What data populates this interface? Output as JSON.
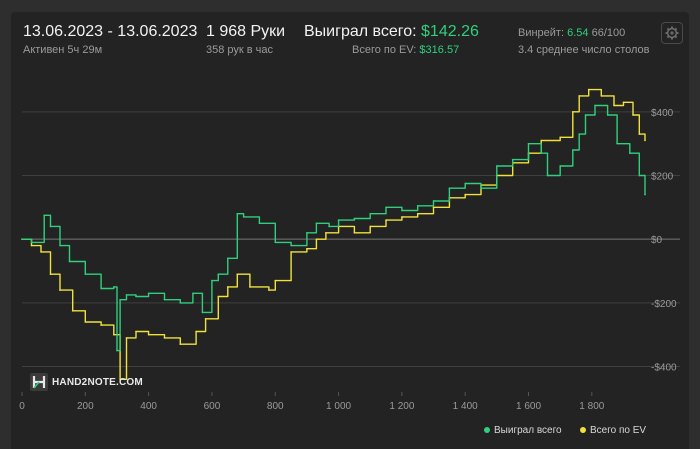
{
  "header": {
    "date_range": "13.06.2023 - 13.06.2023",
    "active": "Активен 5ч 29м",
    "hands": "1 968 Руки",
    "hands_per_hour": "358 рук в час",
    "won_label": "Выиграл всего:",
    "won_value": "$142.26",
    "ev_label": "Всего по EV:",
    "ev_value": "$316.57",
    "winrate_label": "Винрейт:",
    "winrate_value": "6.54",
    "winrate_suffix": "66/100",
    "tables": "3.4 среднее число столов"
  },
  "logo": {
    "text": "HAND2NOTE.COM"
  },
  "icons": {
    "settings": "gear-icon",
    "logo": "hand2note-logo-icon"
  },
  "colors": {
    "won": "#2ed07d",
    "ev": "#f0e23a",
    "accent_green": "#2ed07d",
    "grid": "#555555"
  },
  "chart_data": {
    "type": "line",
    "x_ticks": [
      "0",
      "200",
      "400",
      "600",
      "800",
      "1 000",
      "1 200",
      "1 400",
      "1 600",
      "1 800"
    ],
    "y_ticks": [
      "$400",
      "$200",
      "$0",
      "-$200",
      "-$400"
    ],
    "xlim": [
      0,
      1968
    ],
    "ylim": [
      -480,
      500
    ],
    "legend_position": "bottom-right",
    "series": [
      {
        "name": "Выиграл всего",
        "color": "#2ed07d",
        "x": [
          0,
          30,
          70,
          90,
          120,
          150,
          200,
          250,
          290,
          300,
          310,
          330,
          360,
          400,
          450,
          500,
          540,
          570,
          600,
          620,
          650,
          680,
          700,
          750,
          800,
          850,
          900,
          930,
          970,
          1000,
          1050,
          1100,
          1150,
          1200,
          1250,
          1300,
          1350,
          1400,
          1450,
          1500,
          1550,
          1600,
          1640,
          1660,
          1700,
          1740,
          1760,
          1780,
          1810,
          1850,
          1880,
          1920,
          1950,
          1968
        ],
        "y": [
          0,
          -10,
          75,
          40,
          -20,
          -70,
          -110,
          -155,
          -150,
          -350,
          -190,
          -175,
          -180,
          -170,
          -190,
          -200,
          -170,
          -230,
          -130,
          -110,
          -60,
          80,
          70,
          50,
          -10,
          -20,
          20,
          50,
          40,
          60,
          65,
          80,
          100,
          90,
          105,
          120,
          160,
          175,
          160,
          230,
          250,
          300,
          270,
          200,
          230,
          280,
          330,
          390,
          420,
          390,
          300,
          270,
          200,
          140
        ]
      },
      {
        "name": "Всего по EV",
        "color": "#f0e23a",
        "x": [
          0,
          30,
          60,
          90,
          120,
          160,
          200,
          250,
          290,
          310,
          330,
          360,
          400,
          450,
          500,
          550,
          580,
          620,
          650,
          680,
          720,
          780,
          800,
          850,
          900,
          930,
          960,
          1000,
          1050,
          1100,
          1150,
          1200,
          1250,
          1300,
          1350,
          1400,
          1450,
          1500,
          1550,
          1600,
          1640,
          1700,
          1740,
          1760,
          1790,
          1830,
          1870,
          1900,
          1930,
          1950,
          1968
        ],
        "y": [
          0,
          -20,
          -40,
          -110,
          -160,
          -225,
          -260,
          -270,
          -300,
          -440,
          -310,
          -290,
          -300,
          -310,
          -330,
          -290,
          -250,
          -180,
          -150,
          -110,
          -150,
          -160,
          -130,
          -40,
          -30,
          0,
          20,
          40,
          20,
          40,
          60,
          70,
          80,
          100,
          130,
          140,
          170,
          200,
          240,
          270,
          310,
          320,
          400,
          450,
          470,
          450,
          420,
          430,
          390,
          330,
          310
        ]
      }
    ]
  }
}
